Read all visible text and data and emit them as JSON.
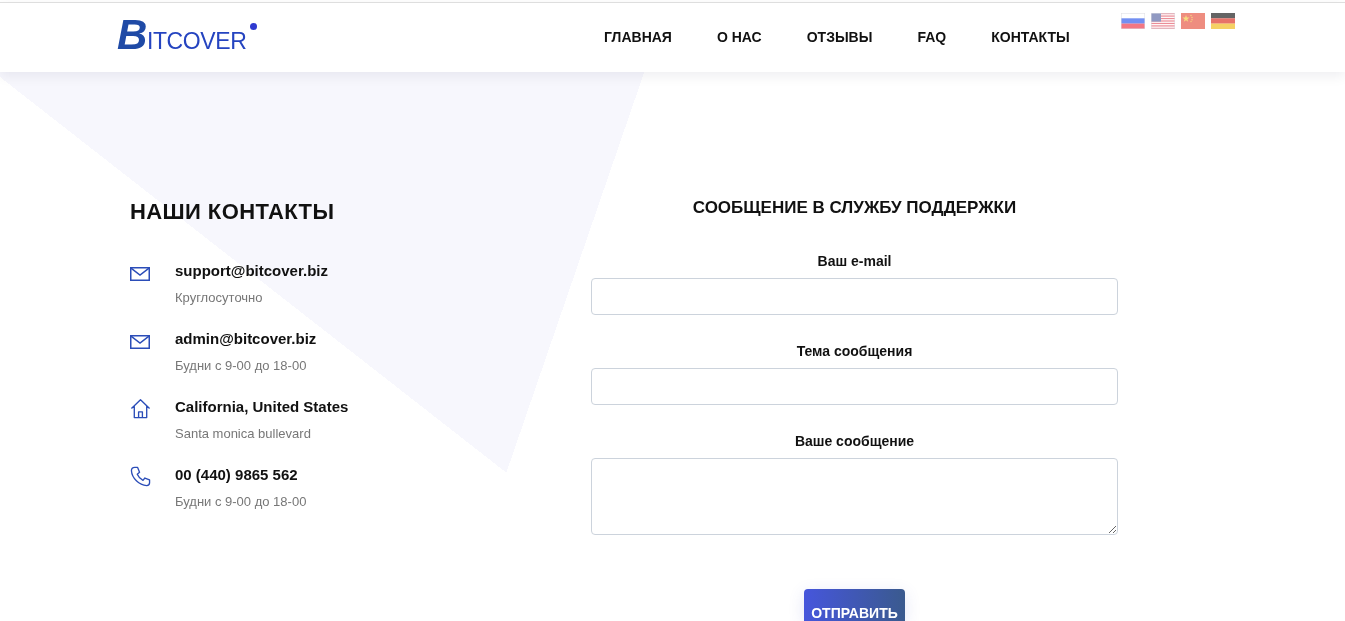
{
  "header": {
    "logo": "BITCOVER",
    "nav": [
      {
        "label": "ГЛАВНАЯ"
      },
      {
        "label": "О НАС"
      },
      {
        "label": "ОТЗЫВЫ"
      },
      {
        "label": "FAQ"
      },
      {
        "label": "КОНТАКТЫ"
      }
    ],
    "languages": [
      {
        "kind": "ru"
      },
      {
        "kind": "us"
      },
      {
        "kind": "cn"
      },
      {
        "kind": "de"
      }
    ]
  },
  "contacts": {
    "title": "НАШИ КОНТАКТЫ",
    "items": [
      {
        "kind": "email",
        "title": "support@bitcover.biz",
        "subtitle": "Круглосуточно"
      },
      {
        "kind": "email",
        "title": "admin@bitcover.biz",
        "subtitle": "Будни с 9-00 до 18-00"
      },
      {
        "kind": "address",
        "title": "California, United States",
        "subtitle": "Santa monica bullevard"
      },
      {
        "kind": "phone",
        "title": "00 (440) 9865 562",
        "subtitle": "Будни с 9-00 до 18-00"
      }
    ]
  },
  "form": {
    "title": "СООБЩЕНИЕ В СЛУЖБУ ПОДДЕРЖКИ",
    "fields": [
      {
        "kind": "input",
        "label": "Ваш e-mail"
      },
      {
        "kind": "input",
        "label": "Тема сообщения"
      },
      {
        "kind": "textarea",
        "label": "Ваше сообщение"
      }
    ],
    "submit": "ОТПРАВИТЬ"
  }
}
